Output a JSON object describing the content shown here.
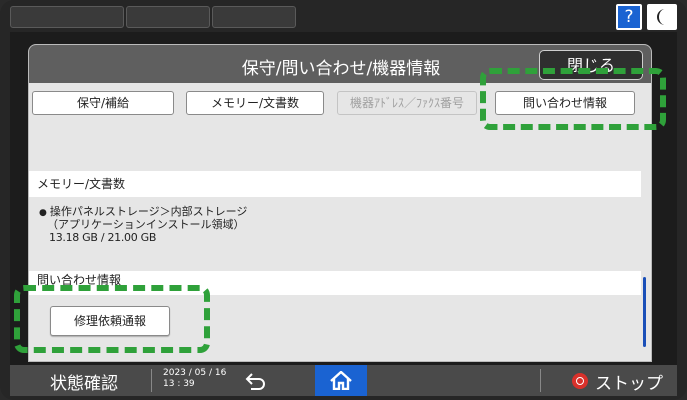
{
  "dialog": {
    "title": "保守/問い合わせ/機器情報",
    "close_label": "閉じる"
  },
  "tabs": [
    {
      "label": "保守/補給",
      "state": "normal"
    },
    {
      "label": "メモリー/文書数",
      "state": "normal"
    },
    {
      "label": "機器ｱﾄﾞﾚｽ／ﾌｧｸｽ番号",
      "state": "disabled"
    },
    {
      "label": "問い合わせ情報",
      "state": "normal"
    }
  ],
  "memory": {
    "heading": "メモリー/文書数",
    "line1": "操作パネルストレージ＞内部ストレージ",
    "line2": "（アプリケーションインストール領域）",
    "line3": "13.18 GB / 21.00 GB"
  },
  "inquiry": {
    "heading": "問い合わせ情報",
    "repair_button": "修理依頼通報"
  },
  "statusbar": {
    "status_label": "状態確認",
    "date": "2023 / 05 / 16",
    "time": "13 : 39",
    "stop_label": "ストップ"
  },
  "colors": {
    "accent_blue": "#1a63d2",
    "callout_green": "#2fa13a",
    "stop_red": "#d9312b"
  },
  "icons": {
    "help": "?",
    "night_mode": "moon-icon",
    "back": "back-arrow-icon",
    "home": "home-icon",
    "stop": "stop-icon"
  }
}
